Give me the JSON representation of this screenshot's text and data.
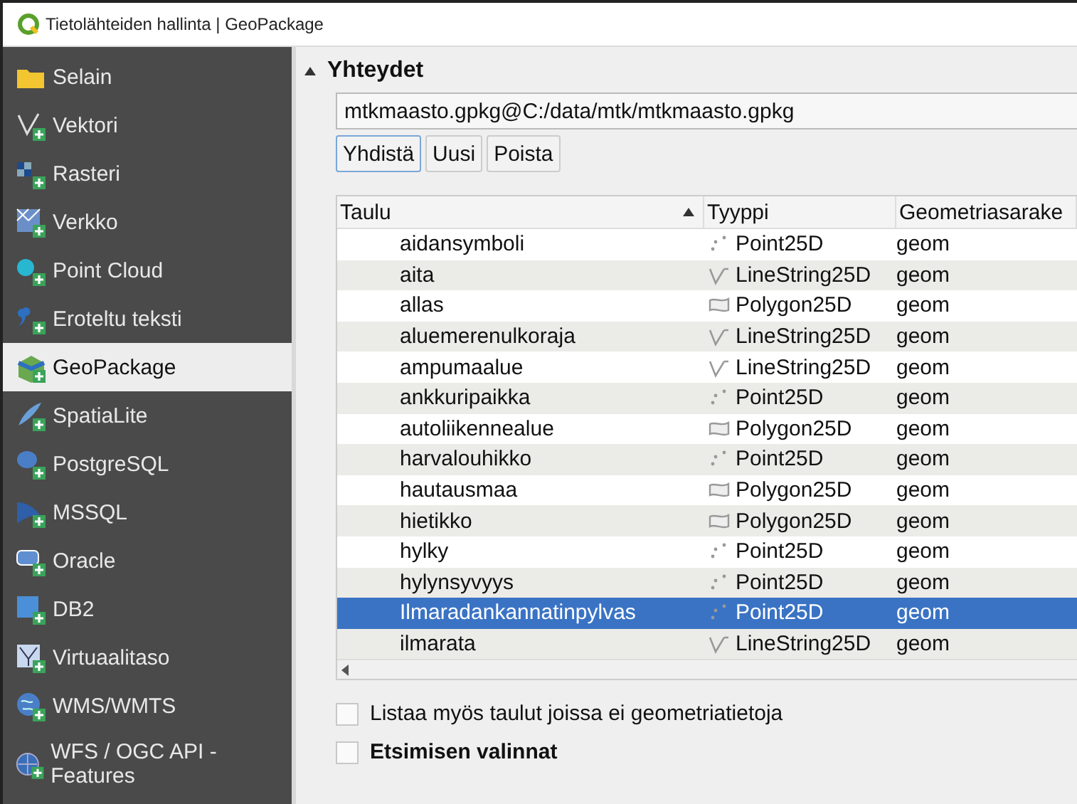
{
  "window": {
    "title": "Tietolähteiden hallinta | GeoPackage"
  },
  "sidebar": {
    "items": [
      {
        "label": "Selain",
        "selected": false
      },
      {
        "label": "Vektori",
        "selected": false
      },
      {
        "label": "Rasteri",
        "selected": false
      },
      {
        "label": "Verkko",
        "selected": false
      },
      {
        "label": "Point Cloud",
        "selected": false
      },
      {
        "label": "Eroteltu teksti",
        "selected": false
      },
      {
        "label": "GeoPackage",
        "selected": true
      },
      {
        "label": "SpatiaLite",
        "selected": false
      },
      {
        "label": "PostgreSQL",
        "selected": false
      },
      {
        "label": "MSSQL",
        "selected": false
      },
      {
        "label": "Oracle",
        "selected": false
      },
      {
        "label": "DB2",
        "selected": false
      },
      {
        "label": "Virtuaalitaso",
        "selected": false
      },
      {
        "label": "WMS/WMTS",
        "selected": false
      },
      {
        "label": "WFS / OGC API - Features",
        "selected": false
      }
    ]
  },
  "connections": {
    "title": "Yhteydet",
    "value": "mtkmaasto.gpkg@C:/data/mtk/mtkmaasto.gpkg",
    "buttons": [
      "Yhdistä",
      "Uusi",
      "Poista"
    ]
  },
  "table": {
    "columns": [
      "Taulu",
      "Tyyppi",
      "Geometriasarake"
    ],
    "rows": [
      {
        "name": "aidansymboli",
        "kind": "point",
        "type": "Point25D",
        "geometry": "geom",
        "selected": false
      },
      {
        "name": "aita",
        "kind": "line",
        "type": "LineString25D",
        "geometry": "geom",
        "selected": false
      },
      {
        "name": "allas",
        "kind": "polygon",
        "type": "Polygon25D",
        "geometry": "geom",
        "selected": false
      },
      {
        "name": "aluemerenulkoraja",
        "kind": "line",
        "type": "LineString25D",
        "geometry": "geom",
        "selected": false
      },
      {
        "name": "ampumaalue",
        "kind": "line",
        "type": "LineString25D",
        "geometry": "geom",
        "selected": false
      },
      {
        "name": "ankkuripaikka",
        "kind": "point",
        "type": "Point25D",
        "geometry": "geom",
        "selected": false
      },
      {
        "name": "autoliikennealue",
        "kind": "polygon",
        "type": "Polygon25D",
        "geometry": "geom",
        "selected": false
      },
      {
        "name": "harvalouhikko",
        "kind": "point",
        "type": "Point25D",
        "geometry": "geom",
        "selected": false
      },
      {
        "name": "hautausmaa",
        "kind": "polygon",
        "type": "Polygon25D",
        "geometry": "geom",
        "selected": false
      },
      {
        "name": "hietikko",
        "kind": "polygon",
        "type": "Polygon25D",
        "geometry": "geom",
        "selected": false
      },
      {
        "name": "hylky",
        "kind": "point",
        "type": "Point25D",
        "geometry": "geom",
        "selected": false
      },
      {
        "name": "hylynsyvyys",
        "kind": "point",
        "type": "Point25D",
        "geometry": "geom",
        "selected": false
      },
      {
        "name": "Ilmaradankannatinpylvas",
        "kind": "point",
        "type": "Point25D",
        "geometry": "geom",
        "selected": true
      },
      {
        "name": "ilmarata",
        "kind": "line",
        "type": "LineString25D",
        "geometry": "geom",
        "selected": false
      }
    ]
  },
  "options": [
    {
      "label": "Listaa myös taulut joissa ei geometriatietoja",
      "kind": "checkbox",
      "checked": false
    },
    {
      "label": "Etsimisen valinnat",
      "kind": "group",
      "checked": false
    }
  ]
}
